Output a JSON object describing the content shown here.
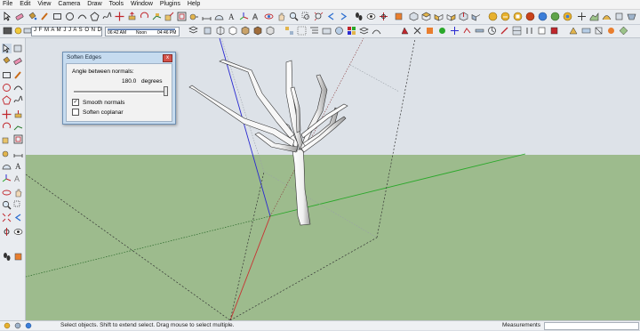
{
  "menu": [
    "File",
    "Edit",
    "View",
    "Camera",
    "Draw",
    "Tools",
    "Window",
    "Plugins",
    "Help"
  ],
  "shadow_bar": {
    "months": "J F M A M J J A S O N D",
    "time_start": "06:42 AM",
    "time_mid": "Noon",
    "time_end": "04:46 PM"
  },
  "dialog": {
    "title": "Soften Edges",
    "close": "x",
    "angle_label": "Angle between normals:",
    "angle_value": "180.0",
    "angle_unit": "degrees",
    "slider_level": 1.0,
    "smooth_label": "Smooth normals",
    "smooth_checked": "✓",
    "coplanar_label": "Soften coplanar",
    "coplanar_checked": ""
  },
  "status": {
    "hint": "Select objects. Shift to extend select. Drag mouse to select multiple.",
    "measurements_label": "Measurements",
    "measurements_value": ""
  },
  "colors": {
    "sky": "#dde2e8",
    "ground": "#9dbb8d",
    "axis_red": "#c83232",
    "axis_green": "#2aa82a",
    "axis_blue": "#2a2ad0"
  }
}
